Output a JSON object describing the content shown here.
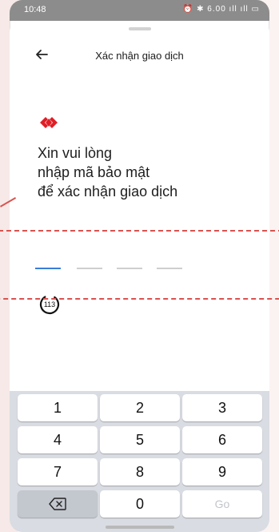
{
  "status_bar": {
    "time": "10:48",
    "icons_text": "⏰ ✱ 6.00 ıll ıll ▭"
  },
  "header": {
    "back_icon": "arrow-left-icon",
    "title": "Xác nhận giao dịch"
  },
  "brand": {
    "logo_icon": "brand-diamond-logo",
    "logo_color": "#e01e26"
  },
  "prompt": {
    "lines": [
      "Xin vui lòng",
      "nhập mã bảo mật",
      "để xác nhận giao dịch"
    ]
  },
  "code_input": {
    "slots": 4,
    "active_index": 0,
    "active_color": "#3a7cd8"
  },
  "timer": {
    "value": "113"
  },
  "keypad": {
    "keys": [
      "1",
      "2",
      "3",
      "4",
      "5",
      "6",
      "7",
      "8",
      "9",
      "⌫",
      "0",
      "Go"
    ],
    "backspace_icon": "backspace-icon"
  },
  "annotation_color": "#d9534f"
}
